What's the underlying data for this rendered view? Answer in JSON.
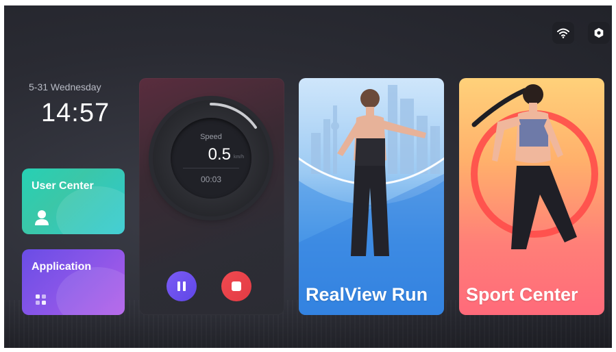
{
  "status_bar": {
    "wifi_icon": "wifi-icon",
    "settings_icon": "gear-icon"
  },
  "clock": {
    "date": "5-31 Wednesday",
    "time": "14:57"
  },
  "tiles": {
    "user_center": {
      "label": "User Center",
      "icon": "user-icon",
      "color": "#2ecdb2"
    },
    "application": {
      "label": "Application",
      "icon": "apps-grid-icon",
      "color": "#7b52e8"
    }
  },
  "speed_panel": {
    "label": "Speed",
    "value": "0.5",
    "unit": "km/h",
    "timer": "00:03",
    "pause_color": "#6b4ff0",
    "stop_color": "#e84249"
  },
  "cards": {
    "realview": {
      "title": "RealView Run",
      "color": "#4f9be7"
    },
    "sport": {
      "title": "Sport Center",
      "color": "#ff8a72"
    }
  }
}
